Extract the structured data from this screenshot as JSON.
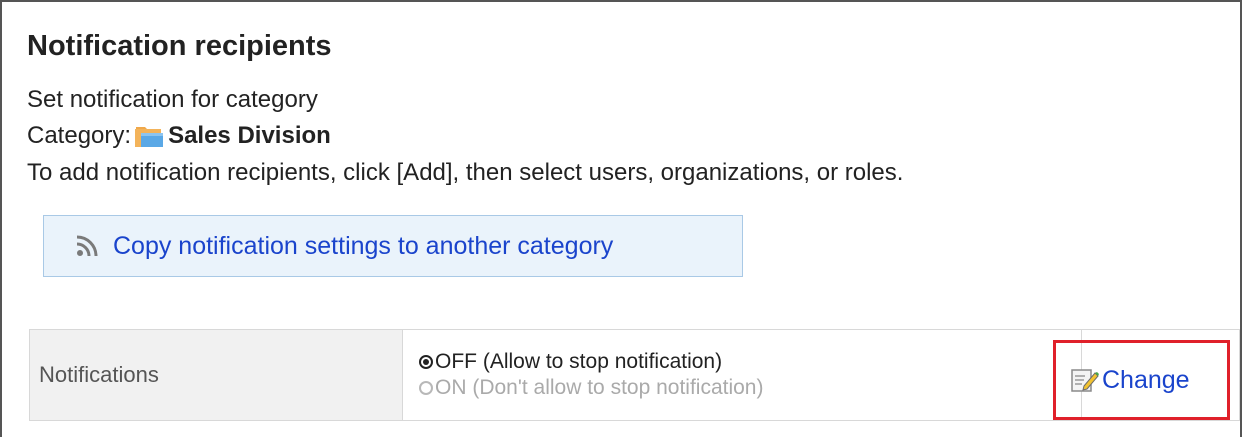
{
  "section": {
    "title": "Notification recipients",
    "subtitle": "Set notification for category",
    "category_label": "Category:",
    "category_name": "Sales Division",
    "instruction": "To add notification recipients, click [Add], then select users, organizations, or roles."
  },
  "copy_button": {
    "label": "Copy notification settings to another category",
    "icon": "feed-icon"
  },
  "notifications": {
    "label": "Notifications",
    "options": [
      {
        "label": "OFF (Allow to stop notification)",
        "selected": true,
        "enabled": true
      },
      {
        "label": "ON (Don't allow to stop notification)",
        "selected": false,
        "enabled": false
      }
    ],
    "change_label": "Change",
    "change_icon": "edit-icon"
  },
  "colors": {
    "link": "#1a44cc",
    "highlight": "#e0202a",
    "button_bg": "#eaf3fb",
    "label_bg": "#f1f1f1"
  }
}
